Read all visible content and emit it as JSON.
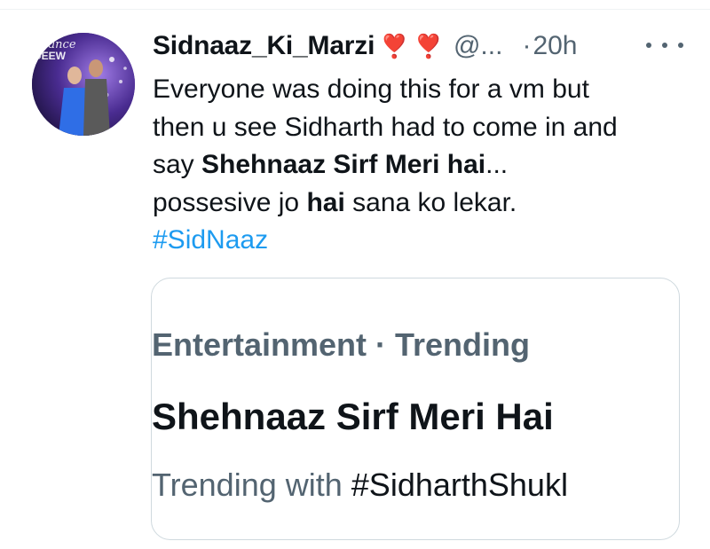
{
  "tweet": {
    "display_name": "Sidnaaz_Ki_Marzi",
    "heart_emoji_1": "❣️",
    "heart_emoji_2": "❣️",
    "handle": "@...",
    "separator": "·",
    "time": "20h",
    "more_icon": "more-horizontal-icon",
    "avatar_text": "DANCE DEEW",
    "text_lines": [
      {
        "a": "Everyone was doing this for a vm but"
      },
      {
        "a": "then u see Sidharth had to come in and"
      },
      {
        "a": "say ",
        "b": "Shehnaaz Sirf Meri hai",
        "c": "..."
      },
      {
        "a": "possesive jo ",
        "b": "hai",
        "c": " sana ko lekar."
      }
    ],
    "hashtag": "#SidNaaz"
  },
  "trend_card": {
    "context": "Entertainment · Trending",
    "title": "Shehnaaz Sirf Meri Hai",
    "sub_prefix": "Trending with ",
    "sub_tag": "#SidharthShukl"
  },
  "colors": {
    "primary_text": "#0f1419",
    "secondary_text": "#536471",
    "link": "#1d9bf0",
    "border": "#cfd9de",
    "heart": "#d62a33"
  }
}
